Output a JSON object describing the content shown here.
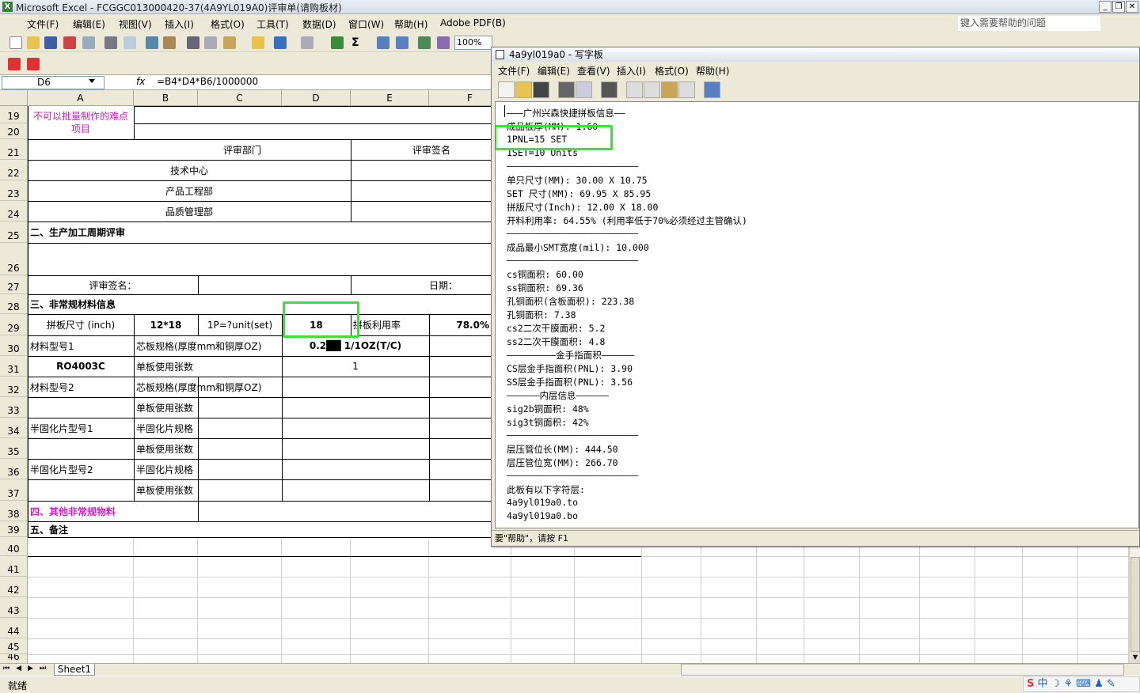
{
  "excel": {
    "title": "Microsoft Excel - FCGGC013000420-37(4A9YL019A0)评审单(请购板材)",
    "menu": [
      "文件(F)",
      "编辑(E)",
      "视图(V)",
      "插入(I)",
      "格式(O)",
      "工具(T)",
      "数据(D)",
      "窗口(W)",
      "帮助(H)",
      "Adobe PDF(B)"
    ],
    "help_placeholder": "键入需要帮助的问题",
    "zoom": "100%",
    "font_name": "宋体",
    "font_size": "10",
    "name_box": "D6",
    "fx": "fx",
    "formula": "=B4*D4*B6/1000000",
    "columns": [
      "A",
      "B",
      "C",
      "D",
      "E",
      "F"
    ],
    "rows": [
      "19",
      "20",
      "21",
      "22",
      "23",
      "24",
      "25",
      "26",
      "27",
      "28",
      "29",
      "30",
      "31",
      "32",
      "33",
      "34",
      "35",
      "36",
      "37",
      "38",
      "39",
      "40",
      "41",
      "42",
      "43",
      "44",
      "45",
      "46"
    ],
    "cells": {
      "r19a": "不可以批量制作的难点项目",
      "review_dept": "评审部门",
      "review_sign": "评审签名",
      "tech_center": "技术中心",
      "prod_eng": "产品工程部",
      "quality": "品质管理部",
      "sec2": "二、生产加工周期评审",
      "sign_label": "评审签名：",
      "date_label": "日期：",
      "sec3": "三、非常规材料信息",
      "panel_size": "拼板尺寸 (inch)",
      "panel_size_val": "12*18",
      "p_unit": "1P=?unit(set)",
      "p_unit_val": "18",
      "util_label": "拼板利用率",
      "util_val": "78.0%",
      "mat1": "材料型号1",
      "core_spec1": "芯板规格(厚度mm和铜厚OZ)",
      "core_spec1_val": "0.2██ 1/1OZ(T/C)",
      "mat1_val": "RO4003C",
      "sheet_count1": "单板使用张数",
      "sheet_count1_val": "1",
      "mat2": "材料型号2",
      "core_spec2": "芯板规格(厚度mm和铜厚OZ)",
      "sheet_count2": "单板使用张数",
      "pp1": "半固化片型号1",
      "pp_spec1": "半固化片规格",
      "sheet_count3": "单板使用张数",
      "pp2": "半固化片型号2",
      "pp_spec2": "半固化片规格",
      "sheet_count4": "单板使用张数",
      "sec4": "四、其他非常规物料",
      "sec5": "五、备注"
    },
    "sheet_tab": "Sheet1",
    "status": "就绪"
  },
  "wordpad": {
    "title": "4a9yl019a0 - 写字板",
    "menu": [
      "文件(F)",
      "编辑(E)",
      "查看(V)",
      "插入(I)",
      "格式(O)",
      "帮助(H)"
    ],
    "lines": [
      "———广州兴森快捷拼板信息——",
      "成品板厚(MM): 1.60",
      "1PNL=15 SET",
      "1SET=10 Units",
      "————————————————————————",
      "单只尺寸(MM): 30.00 X 10.75",
      "SET 尺寸(MM): 69.95 X 85.95",
      "拼版尺寸(Inch): 12.00 X 18.00",
      "开料利用率: 64.55% (利用率低于70%必须经过主管确认)",
      "————————————————————————",
      "成品最小SMT宽度(mil): 10.000",
      "————————————————————————",
      "cs铜面积: 60.00",
      "ss铜面积: 69.36",
      "孔铜面积(含板面积): 223.38",
      "孔铜面积: 7.38",
      "cs2二次干膜面积: 5.2",
      "ss2二次干膜面积: 4.8",
      "—————————金手指面积——————",
      "CS层金手指面积(PNL): 3.90",
      "SS层金手指面积(PNL): 3.56",
      "——————内层信息——————",
      "sig2b铜面积: 48%",
      "sig3t铜面积: 42%",
      "————————————————————————",
      "层压管位长(MM): 444.50",
      "层压管位宽(MM): 266.70",
      "————————————————————————",
      "此板有以下字符层:",
      "4a9yl019a0.to",
      "4a9yl019a0.bo"
    ],
    "status": "要\"帮助\"，请按 F1"
  }
}
